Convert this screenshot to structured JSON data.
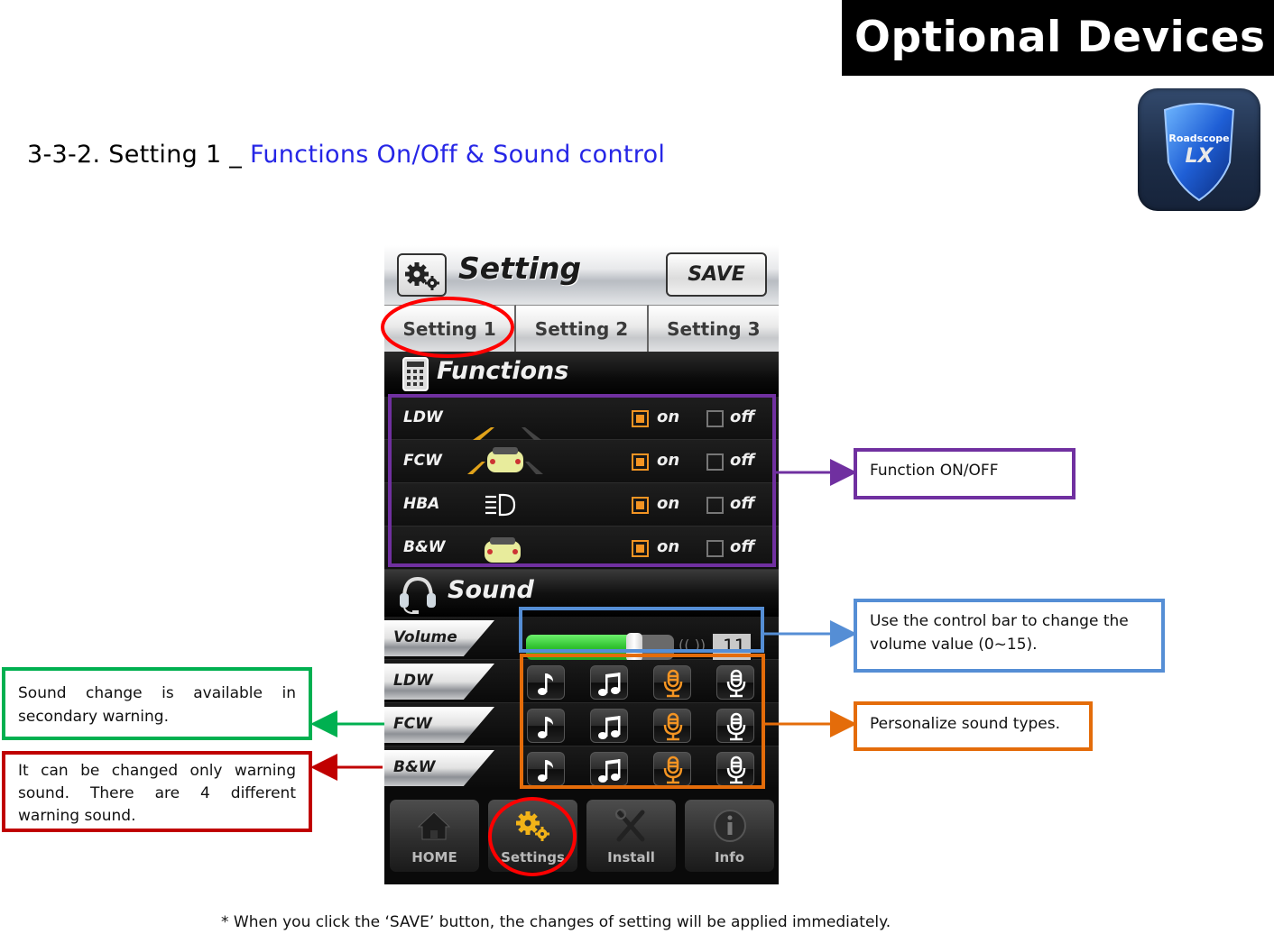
{
  "banner": {
    "title": "Optional Devices"
  },
  "section": {
    "prefix": "3-3-2. Setting 1 _ ",
    "highlight": "Functions On/Off & Sound control",
    "highlight_color": "#2626e6"
  },
  "app_icon": {
    "name": "Roadscope LX",
    "line1": "Roadscope",
    "line2": "LX"
  },
  "phone": {
    "header": {
      "title": "Setting",
      "icon": "gear-icon",
      "save_label": "SAVE"
    },
    "tabs": [
      {
        "label": "Setting 1",
        "active": true
      },
      {
        "label": "Setting 2",
        "active": false
      },
      {
        "label": "Setting 3",
        "active": false
      }
    ],
    "functions": {
      "title": "Functions",
      "icon": "calculator-icon",
      "on_label": "on",
      "off_label": "off",
      "rows": [
        {
          "name": "LDW",
          "icon": "lane-departure-icon",
          "state": "on"
        },
        {
          "name": "FCW",
          "icon": "forward-collision-icon",
          "state": "on"
        },
        {
          "name": "HBA",
          "icon": "high-beam-icon",
          "state": "on"
        },
        {
          "name": "B&W",
          "icon": "car-icon",
          "state": "on"
        }
      ]
    },
    "sound": {
      "title": "Sound",
      "icon": "headset-icon",
      "volume": {
        "label": "Volume",
        "value": "11",
        "min": 0,
        "max": 15,
        "fraction": 0.73
      },
      "sound_types": [
        "single-note-icon",
        "double-note-icon",
        "microphone-orange-icon",
        "microphone-white-icon"
      ],
      "rows": [
        {
          "name": "LDW",
          "selected": 2
        },
        {
          "name": "FCW",
          "selected": 2
        },
        {
          "name": "B&W",
          "selected": 2
        }
      ]
    },
    "nav": [
      {
        "label": "HOME",
        "icon": "home-icon",
        "active": false
      },
      {
        "label": "Settings",
        "icon": "gears-icon",
        "active": true
      },
      {
        "label": "Install",
        "icon": "tools-icon",
        "active": false
      },
      {
        "label": "Info",
        "icon": "info-icon",
        "active": false
      }
    ]
  },
  "annotations": {
    "function_onoff": {
      "text": "Function ON/OFF",
      "color": "#7030a0"
    },
    "volume": {
      "text": "Use the control bar to change the volume value (0~15).",
      "color": "#558ed5"
    },
    "sound_types": {
      "text": "Personalize sound types.",
      "color": "#e46c0a"
    },
    "secondary": {
      "text": "Sound change is available in secondary warning.",
      "color": "#00b050"
    },
    "warning_sound": {
      "text": "It can be changed only warning sound. There are 4 different warning sound.",
      "color": "#c00000"
    },
    "highlight_red": "#ff0000"
  },
  "footnote": "* When you click the ‘SAVE’ button, the changes of setting will be applied immediately."
}
